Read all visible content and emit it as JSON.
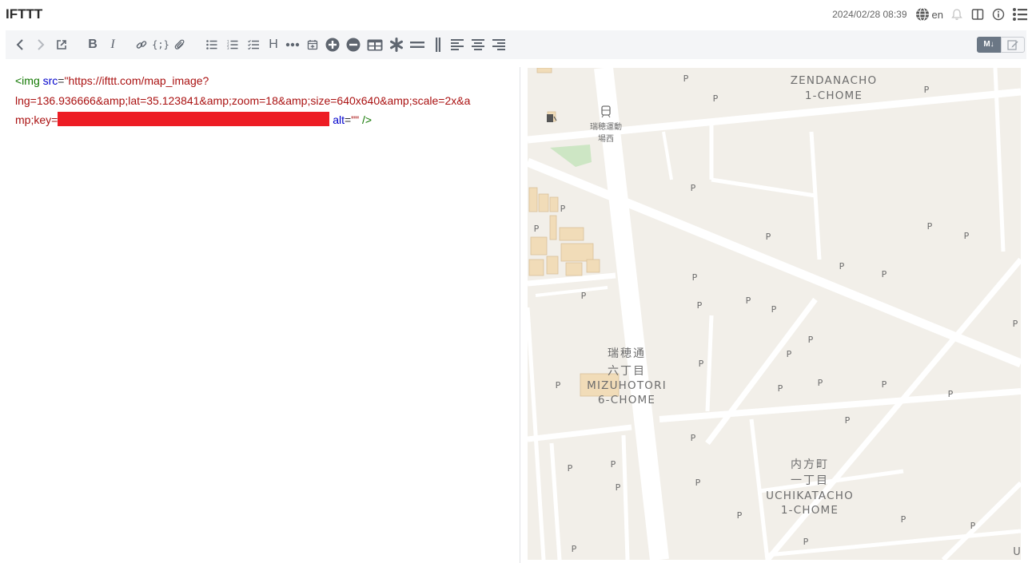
{
  "app": {
    "title": "IFTTT"
  },
  "header": {
    "timestamp": "2024/02/28 08:39",
    "language": "en",
    "icons": [
      "globe-icon",
      "bell-icon",
      "split-view-icon",
      "info-icon",
      "list-icon"
    ]
  },
  "toolbar": {
    "items": [
      "undo",
      "redo",
      "open-external",
      "bold",
      "italic",
      "link",
      "code",
      "attachment",
      "bullet-list",
      "numbered-list",
      "checklist",
      "heading",
      "more",
      "calendar",
      "add-row",
      "remove-row",
      "table",
      "asterisk",
      "horizontal-rule",
      "column",
      "align-left",
      "align-center",
      "align-right"
    ],
    "heading_label": "H",
    "mode_markdown": "M↓",
    "mode_edit": "edit-icon"
  },
  "editor": {
    "tag_open": "<img",
    "attr_src": "src",
    "src_value_line1": "\"https://ifttt.com/map_image?",
    "src_value_line2": "lng=136.936666&amp;lat=35.123841&amp;zoom=18&amp;size=640x640&amp;scale=2x&a",
    "src_value_line3": "mp;key=",
    "attr_alt": "alt",
    "alt_value": "\"\"",
    "tag_close": "/>"
  },
  "map": {
    "labels": {
      "zendanacho": "ZENDANACHO",
      "zendanacho_chome": "1-CHOME",
      "station_jp_1": "瑞穂運動",
      "station_jp_2": "場西",
      "mizuhotori_jp_1": "瑞穂通",
      "mizuhotori_jp_2": "六丁目",
      "mizuhotori": "MIZUHOTORI",
      "mizuhotori_chome": "6-CHOME",
      "uchikatacho_jp_1": "内方町",
      "uchikatacho_jp_2": "一丁目",
      "uchikatacho": "UCHIKATACHO",
      "uchikatacho_chome": "1-CHOME",
      "edge_u": "U",
      "parking": "P"
    },
    "colors": {
      "land": "#f2efe9",
      "road": "#ffffff",
      "building": "#f1dcb8",
      "park": "#cde6c4"
    }
  }
}
